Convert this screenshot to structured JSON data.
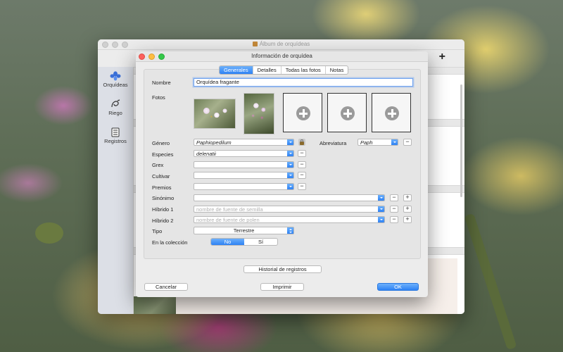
{
  "main_window": {
    "title": "Álbum de orquídeas",
    "add_label": "+",
    "sidebar": [
      {
        "label": "Orquídeas",
        "icon": "orchid-icon"
      },
      {
        "label": "Riego",
        "icon": "watering-icon"
      },
      {
        "label": "Registros",
        "icon": "records-icon"
      }
    ]
  },
  "dialog": {
    "title": "Información de orquídea",
    "tabs": [
      {
        "label": "Generales",
        "active": true
      },
      {
        "label": "Detalles",
        "active": false
      },
      {
        "label": "Todas las fotos",
        "active": false
      },
      {
        "label": "Notas",
        "active": false
      }
    ],
    "labels": {
      "nombre": "Nombre",
      "fotos": "Fotos",
      "genero": "Género",
      "abreviatura": "Abreviatura",
      "especies": "Especies",
      "grex": "Grex",
      "cultivar": "Cultivar",
      "premios": "Premios",
      "sinonimo": "Sinónimo",
      "hibrido1": "Híbrido 1",
      "hibrido2": "Híbrido 2",
      "tipo": "Tipo",
      "en_coleccion": "En la colección"
    },
    "values": {
      "nombre": "Orquídea fragante",
      "genero": "Paphiopedilum",
      "abreviatura": "Paph",
      "especies": "delenatii",
      "grex": "",
      "cultivar": "",
      "premios": "",
      "sinonimo": "",
      "tipo": "Terrestre"
    },
    "placeholders": {
      "hibrido1": "nombre de fuente de semilla",
      "hibrido2": "nombre de fuente de polen"
    },
    "symbols": {
      "minus": "−",
      "plus": "+"
    },
    "en_coleccion": {
      "options": [
        "No",
        "Sí"
      ],
      "selected": "No"
    },
    "buttons": {
      "historial": "Historial de registros",
      "cancelar": "Cancelar",
      "imprimir": "Imprimir",
      "ok": "OK"
    },
    "colors": {
      "accent": "#2e82f4",
      "close": "#fc615d",
      "minimize": "#fdbd41",
      "zoom": "#34c84a"
    }
  }
}
